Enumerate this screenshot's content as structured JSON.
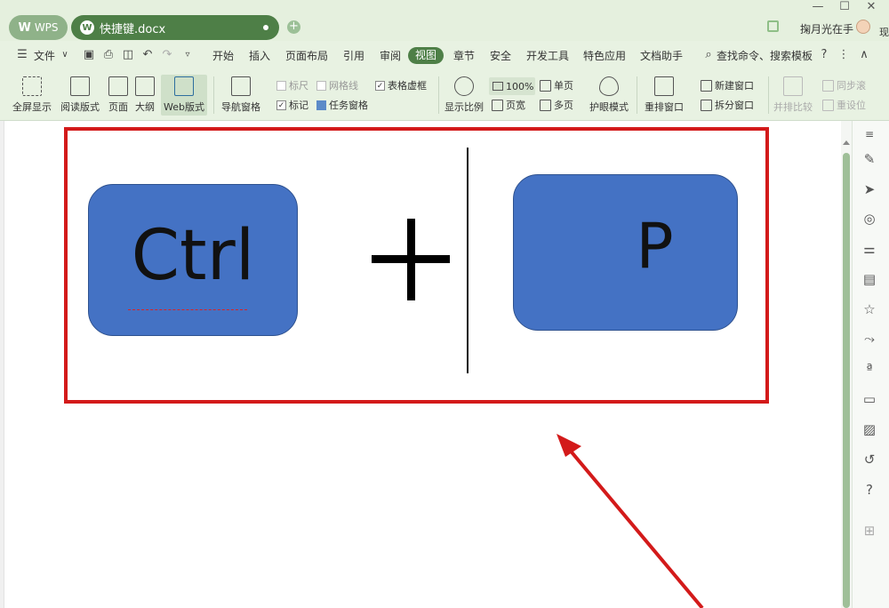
{
  "titlebar": {
    "wps_tab": "WPS",
    "doc_tab": "快捷键.docx",
    "user_name": "掬月光在手",
    "extra_glyph": "现"
  },
  "menubar": {
    "file": "文件",
    "items": [
      "开始",
      "插入",
      "页面布局",
      "引用",
      "审阅",
      "视图",
      "章节",
      "安全",
      "开发工具",
      "特色应用",
      "文档助手"
    ],
    "active": "视图",
    "search": "查找命令、搜索模板"
  },
  "ribbon": {
    "fullscreen": "全屏显示",
    "read_mode": "阅读版式",
    "page": "页面",
    "outline": "大纲",
    "web_layout": "Web版式",
    "nav_pane": "导航窗格",
    "ruler": "标尺",
    "gridlines": "网格线",
    "table_lines": "表格虚框",
    "markup": "标记",
    "task_pane": "任务窗格",
    "zoom": "显示比例",
    "zoom_100": "100%",
    "page_width": "页宽",
    "single_page": "单页",
    "multi_page": "多页",
    "eye_mode": "护眼模式",
    "rearrange": "重排窗口",
    "new_window": "新建窗口",
    "split_window": "拆分窗口",
    "side_by_side": "并排比较",
    "sync_scroll": "同步滚",
    "reset_pos": "重设位"
  },
  "document": {
    "key1": "Ctrl",
    "key2": "P"
  },
  "colors": {
    "accent": "#4e7f47",
    "key_fill": "#4472c4",
    "frame": "#d31a1a"
  }
}
